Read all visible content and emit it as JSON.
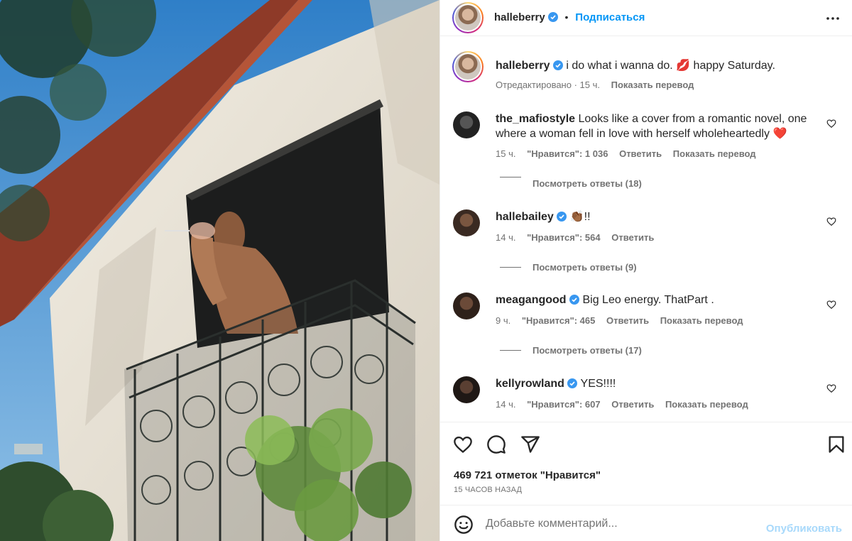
{
  "post": {
    "author": "halleberry",
    "follow_label": "Подписаться",
    "more_icon": "more-horizontal-icon"
  },
  "caption": {
    "username": "halleberry",
    "text_before": "i do what i wanna do.",
    "emoji": "💋",
    "text_after": "happy Saturday.",
    "edited": "Отредактировано · 15 ч.",
    "translate": "Показать перевод"
  },
  "comments": [
    {
      "username": "the_mafiostyle",
      "verified": false,
      "text": "Looks like a cover from a romantic novel, one where a woman fell in love with herself wholeheartedly",
      "emoji": "❤️",
      "time": "15 ч.",
      "likes": "\"Нравится\": 1 036",
      "reply": "Ответить",
      "translate": "Показать перевод",
      "view_replies": "Посмотреть ответы (18)"
    },
    {
      "username": "hallebailey",
      "verified": true,
      "text": "👏🏾!!",
      "time": "14 ч.",
      "likes": "\"Нравится\": 564",
      "reply": "Ответить",
      "view_replies": "Посмотреть ответы (9)"
    },
    {
      "username": "meagangood",
      "verified": true,
      "text": "Big Leo energy. ThatPart .",
      "time": "9 ч.",
      "likes": "\"Нравится\": 465",
      "reply": "Ответить",
      "translate": "Показать перевод",
      "view_replies": "Посмотреть ответы (17)"
    },
    {
      "username": "kellyrowland",
      "verified": true,
      "text": "YES!!!!",
      "time": "14 ч.",
      "likes": "\"Нравится\": 607",
      "reply": "Ответить",
      "translate": "Показать перевод"
    }
  ],
  "actions": {
    "like_icon": "heart-icon",
    "comment_icon": "comment-icon",
    "share_icon": "send-icon",
    "save_icon": "bookmark-icon",
    "likes_count": "469 721 отметок \"Нравится\"",
    "time_ago": "15 ЧАСОВ НАЗАД"
  },
  "add_comment": {
    "placeholder": "Добавьте комментарий...",
    "post_label": "Опубликовать"
  },
  "colors": {
    "accent": "#0095f6",
    "post_disabled": "#a8d9fb",
    "heart_red": "#ed1c24",
    "verified": "#3897f0"
  }
}
